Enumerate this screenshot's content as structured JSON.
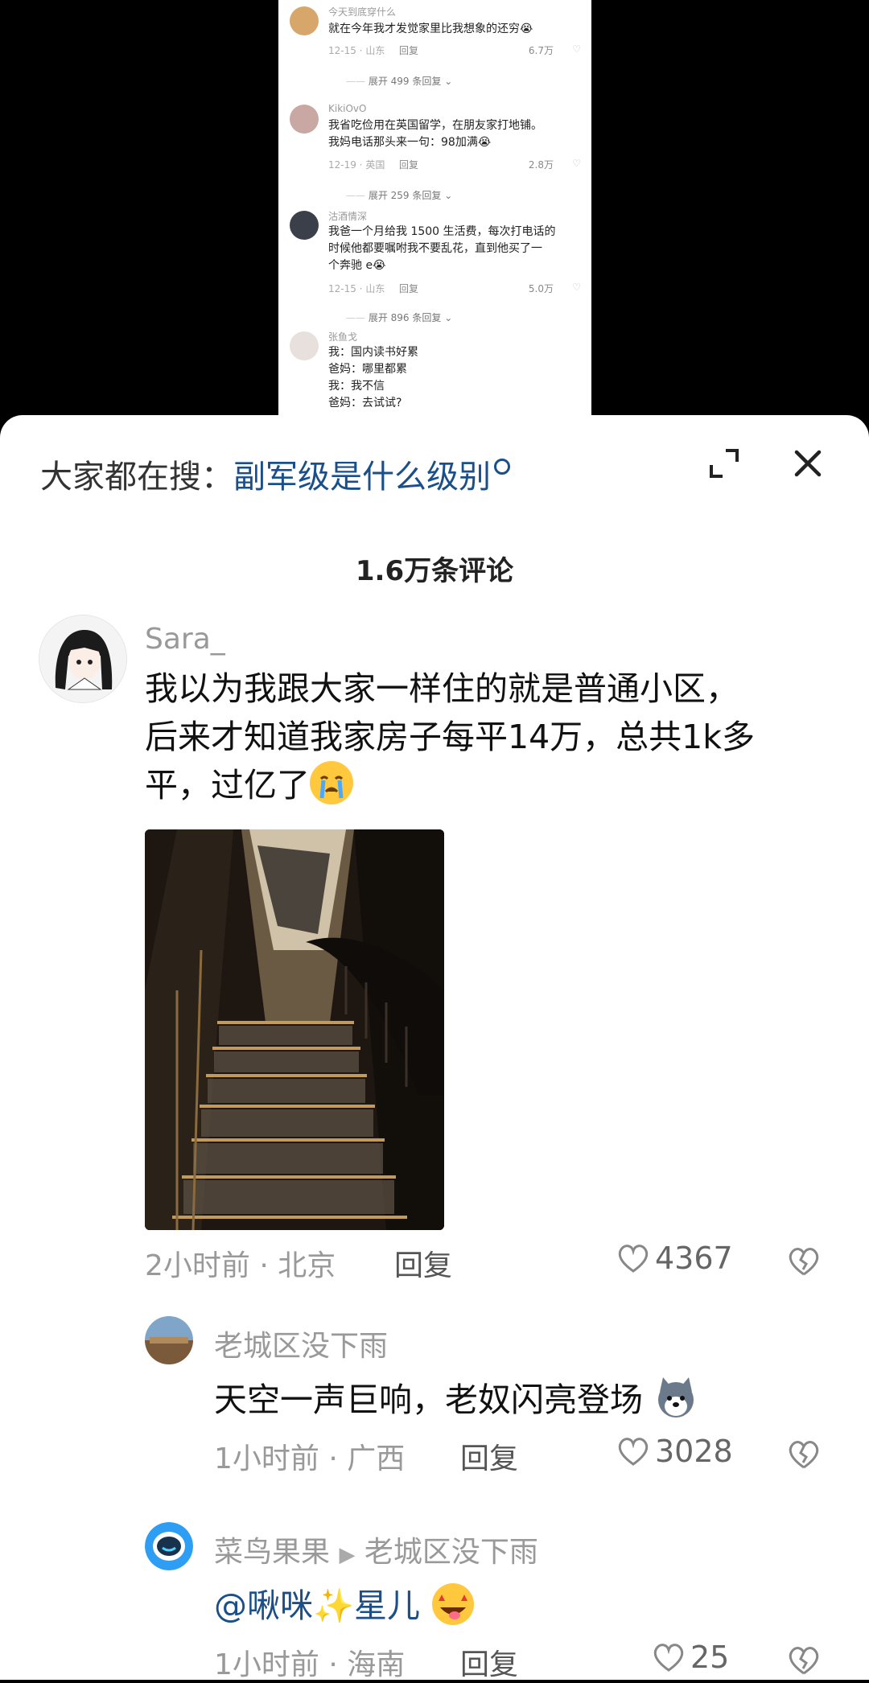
{
  "screenshot": {
    "comments": [
      {
        "user": "今天到底穿什么",
        "text": "就在今年我才发觉家里比我想象的还穷😭",
        "date": "12-15 · 山东",
        "reply": "回复",
        "likes": "6.7万",
        "expand": "展开 499 条回复"
      },
      {
        "user": "KikiOvO",
        "text": "我省吃俭用在英国留学，在朋友家打地铺。\n我妈电话那头来一句：98加满😭",
        "date": "12-19 · 英国",
        "reply": "回复",
        "likes": "2.8万",
        "expand": "展开 259 条回复"
      },
      {
        "user": "沽酒情深",
        "text": "我爸一个月给我 1500 生活费，每次打电话的\n时候他都要嘱咐我不要乱花，直到他买了一\n个奔驰 e😭",
        "date": "12-15 · 山东",
        "reply": "回复",
        "likes": "5.0万",
        "expand": "展开 896 条回复"
      },
      {
        "user": "张鱼戈",
        "text": "我：国内读书好累\n爸妈：哪里都累\n我：我不信\n爸妈：去试试?"
      }
    ]
  },
  "sheet": {
    "search_prefix": "大家都在搜：",
    "search_query": "副军级是什么级别",
    "comment_count": "1.6万条评论"
  },
  "main_comment": {
    "user": "Sara_",
    "text": "我以为我跟大家一样住的就是普通小区，\n后来才知道我家房子每平14万，总共1k多\n平，过亿了",
    "time_location": "2小时前 · 北京",
    "reply_label": "回复",
    "likes": "4367"
  },
  "replies": [
    {
      "user": "老城区没下雨",
      "text": "天空一声巨响，老奴闪亮登场",
      "time_location": "1小时前 · 广西",
      "reply_label": "回复",
      "likes": "3028"
    },
    {
      "user": "菜鸟果果",
      "reply_to": "老城区没下雨",
      "text": "@啾咪✨星儿",
      "time_location": "1小时前 · 海南",
      "reply_label": "回复",
      "likes": "25"
    }
  ],
  "colors": {
    "link": "#1a4f8a",
    "meta": "#999999"
  }
}
